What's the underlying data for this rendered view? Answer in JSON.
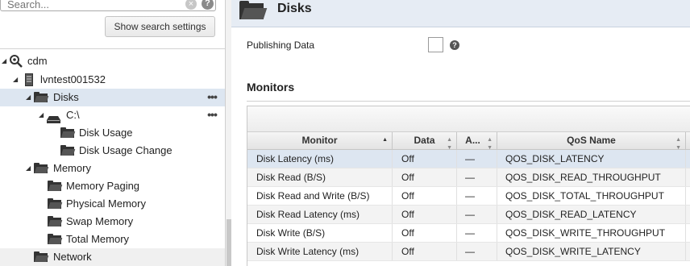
{
  "search": {
    "placeholder": "Search...",
    "clear_icon": "×",
    "help_icon": "?"
  },
  "search_settings_label": "Show search settings",
  "tree": [
    {
      "label": "cdm",
      "icon": "probe-search-icon",
      "arrow": "◢"
    },
    {
      "label": "lvntest001532",
      "icon": "server-icon",
      "arrow": "◢"
    },
    {
      "label": "Disks",
      "icon": "folder-icon",
      "arrow": "◢",
      "selected": true,
      "more": "•••"
    },
    {
      "label": "C:\\",
      "icon": "drive-icon",
      "arrow": "◢",
      "more": "•••"
    },
    {
      "label": "Disk Usage",
      "icon": "folder-icon"
    },
    {
      "label": "Disk Usage Change",
      "icon": "folder-icon"
    },
    {
      "label": "Memory",
      "icon": "folder-icon",
      "arrow": "◢"
    },
    {
      "label": "Memory Paging",
      "icon": "folder-icon"
    },
    {
      "label": "Physical Memory",
      "icon": "folder-icon"
    },
    {
      "label": "Swap Memory",
      "icon": "folder-icon"
    },
    {
      "label": "Total Memory",
      "icon": "folder-icon"
    },
    {
      "label": "Network",
      "icon": "folder-icon"
    }
  ],
  "header": {
    "title": "Disks"
  },
  "property": {
    "label": "Publishing Data",
    "help": "?"
  },
  "monitors": {
    "title": "Monitors",
    "columns": [
      "Monitor",
      "Data",
      "A...",
      "QoS Name"
    ],
    "rows": [
      [
        "Disk Latency (ms)",
        "Off",
        "—",
        "QOS_DISK_LATENCY"
      ],
      [
        "Disk Read (B/S)",
        "Off",
        "—",
        "QOS_DISK_READ_THROUGHPUT"
      ],
      [
        "Disk Read and Write (B/S)",
        "Off",
        "—",
        "QOS_DISK_TOTAL_THROUGHPUT"
      ],
      [
        "Disk Read Latency (ms)",
        "Off",
        "—",
        "QOS_DISK_READ_LATENCY"
      ],
      [
        "Disk Write (B/S)",
        "Off",
        "—",
        "QOS_DISK_WRITE_THROUGHPUT"
      ],
      [
        "Disk Write Latency (ms)",
        "Off",
        "—",
        "QOS_DISK_WRITE_LATENCY"
      ]
    ]
  },
  "colors": {
    "selection": "#dde6f1",
    "header_bg": "#e6ecf4"
  }
}
